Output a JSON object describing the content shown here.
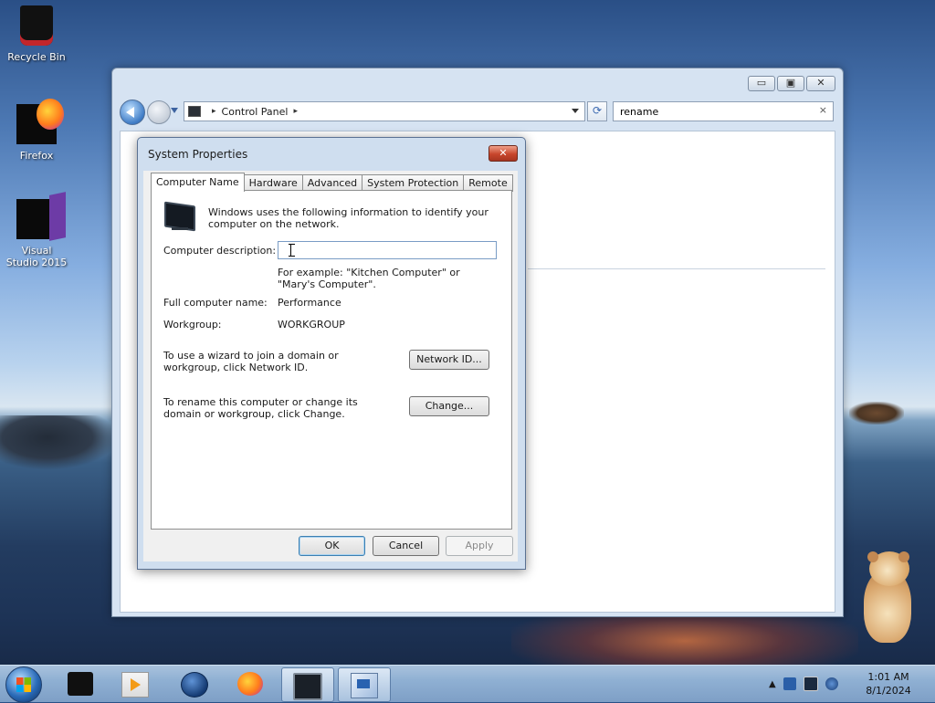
{
  "desktop": {
    "icons": [
      {
        "label": "Recycle Bin",
        "icon": "recycle-bin-icon"
      },
      {
        "label": "Firefox",
        "icon": "firefox-icon"
      },
      {
        "label": "Visual Studio 2015",
        "icon": "visual-studio-icon"
      }
    ]
  },
  "explorer": {
    "window_controls": {
      "minimize": "▭",
      "maximize": "▣",
      "close": "✕"
    },
    "address": {
      "crumb": "Control Panel",
      "separator": "▸"
    },
    "search": {
      "value": "rename",
      "clear": "×"
    }
  },
  "dialog": {
    "title": "System Properties",
    "close": "✕",
    "tabs": [
      "Computer Name",
      "Hardware",
      "Advanced",
      "System Protection",
      "Remote"
    ],
    "active_tab": "Computer Name",
    "intro": "Windows uses the following information to identify your computer on the network.",
    "description_label": "Computer description:",
    "description_value": "",
    "example": "For example: \"Kitchen Computer\" or \"Mary's Computer\".",
    "full_name_label": "Full computer name:",
    "full_name_value": "Performance",
    "workgroup_label": "Workgroup:",
    "workgroup_value": "WORKGROUP",
    "network_id_text": "To use a wizard to join a domain or workgroup, click Network ID.",
    "network_id_button": "Network ID...",
    "rename_text": "To rename this computer or change its domain or workgroup, click Change.",
    "change_button": "Change...",
    "ok_button": "OK",
    "cancel_button": "Cancel",
    "apply_button": "Apply"
  },
  "taskbar": {
    "items": [
      {
        "icon": "black-app-icon",
        "running": false
      },
      {
        "icon": "media-player-icon",
        "running": false
      },
      {
        "icon": "globe-icon",
        "running": false
      },
      {
        "icon": "firefox-icon",
        "running": false
      },
      {
        "icon": "monitor-icon",
        "running": true
      },
      {
        "icon": "system-properties-icon",
        "running": true
      }
    ],
    "tray": {
      "expand": "▲"
    },
    "clock": {
      "time": "1:01 AM",
      "date": "8/1/2024"
    }
  }
}
